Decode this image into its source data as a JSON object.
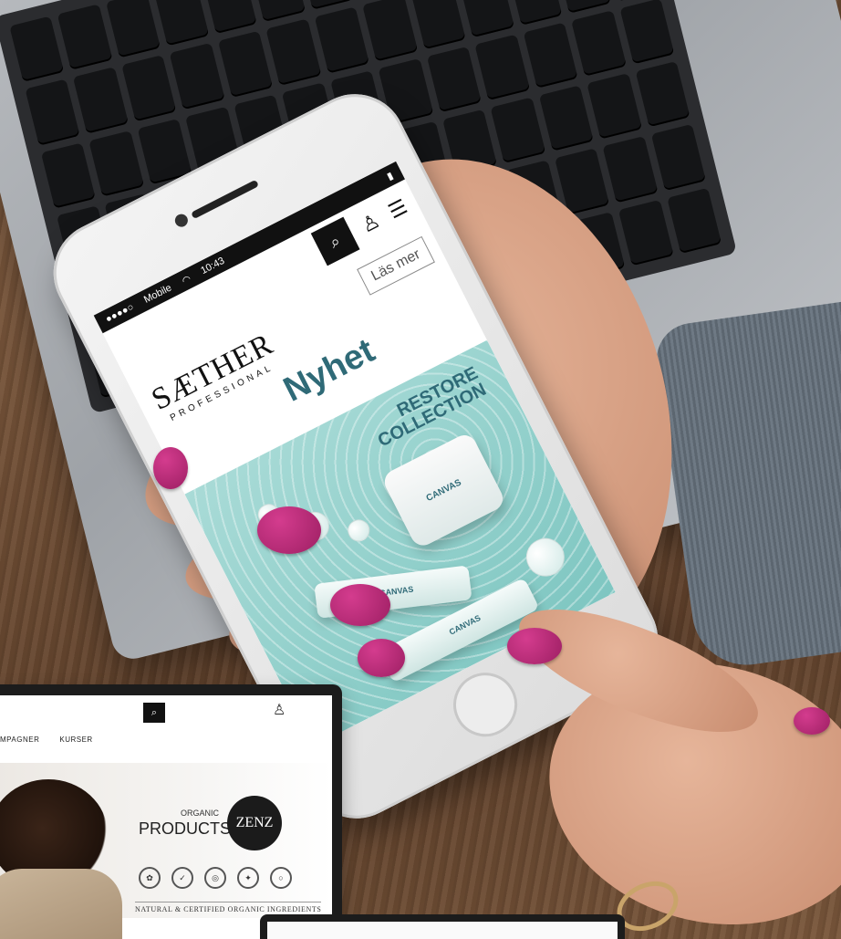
{
  "phone": {
    "status": {
      "carrier": "Mobile",
      "time": "10:43"
    },
    "brand_name": "SÆTHER",
    "brand_sub": "PROFESSIONAL",
    "hero_title": "Nyhet",
    "cta_label": "Läs mer",
    "collection_lines": [
      "RESTORE",
      "COLLECTION"
    ],
    "product_name": "CANVAS"
  },
  "tablet": {
    "menu_items": [
      "MPAGNER",
      "KURSER"
    ],
    "organic_label": "ORGANIC",
    "products_label": "PRODUCTS",
    "logo_text": "ZENZ",
    "cert_badges": [
      "✿",
      "✓",
      "◎",
      "✦",
      "○"
    ],
    "tagline": "NATURAL & CERTIFIED ORGANIC INGREDIENTS"
  },
  "icons": {
    "search": "search-icon",
    "user": "user-icon",
    "menu": "menu-icon"
  },
  "colors": {
    "accent_teal": "#2f6a77",
    "nail_polish": "#b8257a",
    "hero_bg": "#8fd0ca"
  }
}
